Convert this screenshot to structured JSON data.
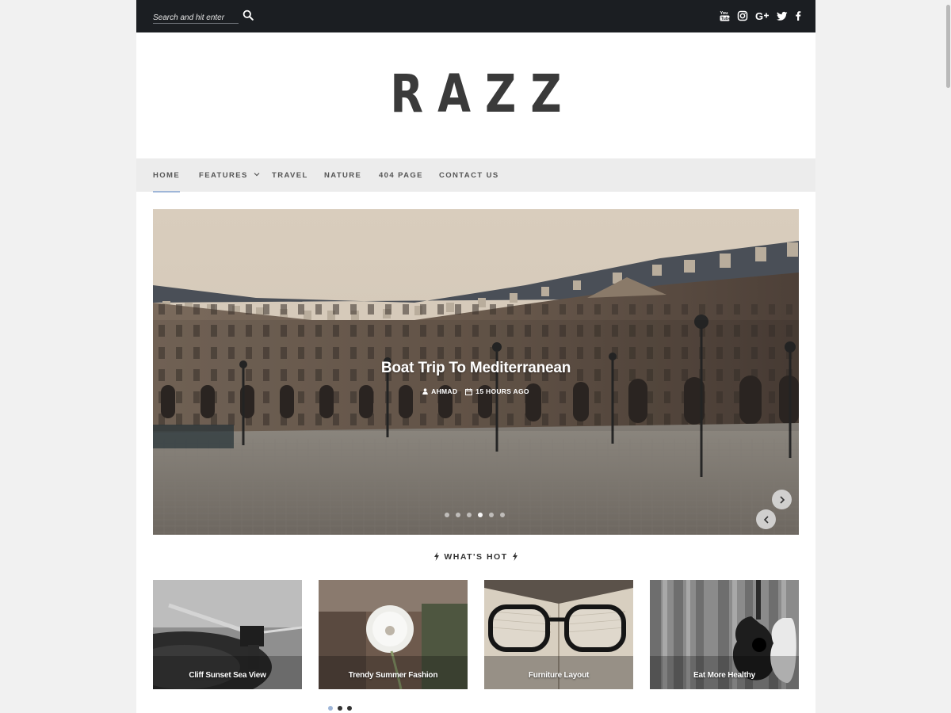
{
  "search": {
    "placeholder": "Search and hit enter"
  },
  "socials": [
    "youtube-icon",
    "instagram-icon",
    "google-plus-icon",
    "twitter-icon",
    "facebook-icon"
  ],
  "logo": "RAZZ",
  "nav": {
    "home": "HOME",
    "features": "FEATURES",
    "travel": "TRAVEL",
    "nature": "NATURE",
    "page404": "404 PAGE",
    "contact": "CONTACT US"
  },
  "hero": {
    "title": "Boat Trip To Mediterranean",
    "author": "AHMAD",
    "time": "15 HOURS AGO"
  },
  "hot": {
    "heading": "WHAT'S HOT",
    "cards": [
      {
        "title": "Cliff Sunset Sea View"
      },
      {
        "title": "Trendy Summer Fashion"
      },
      {
        "title": "Furniture Layout"
      },
      {
        "title": "Eat More Healthy"
      }
    ]
  },
  "colors": {
    "topbar": "#1b1e22",
    "nav": "#ececec",
    "accent": "#9fb6d8"
  }
}
